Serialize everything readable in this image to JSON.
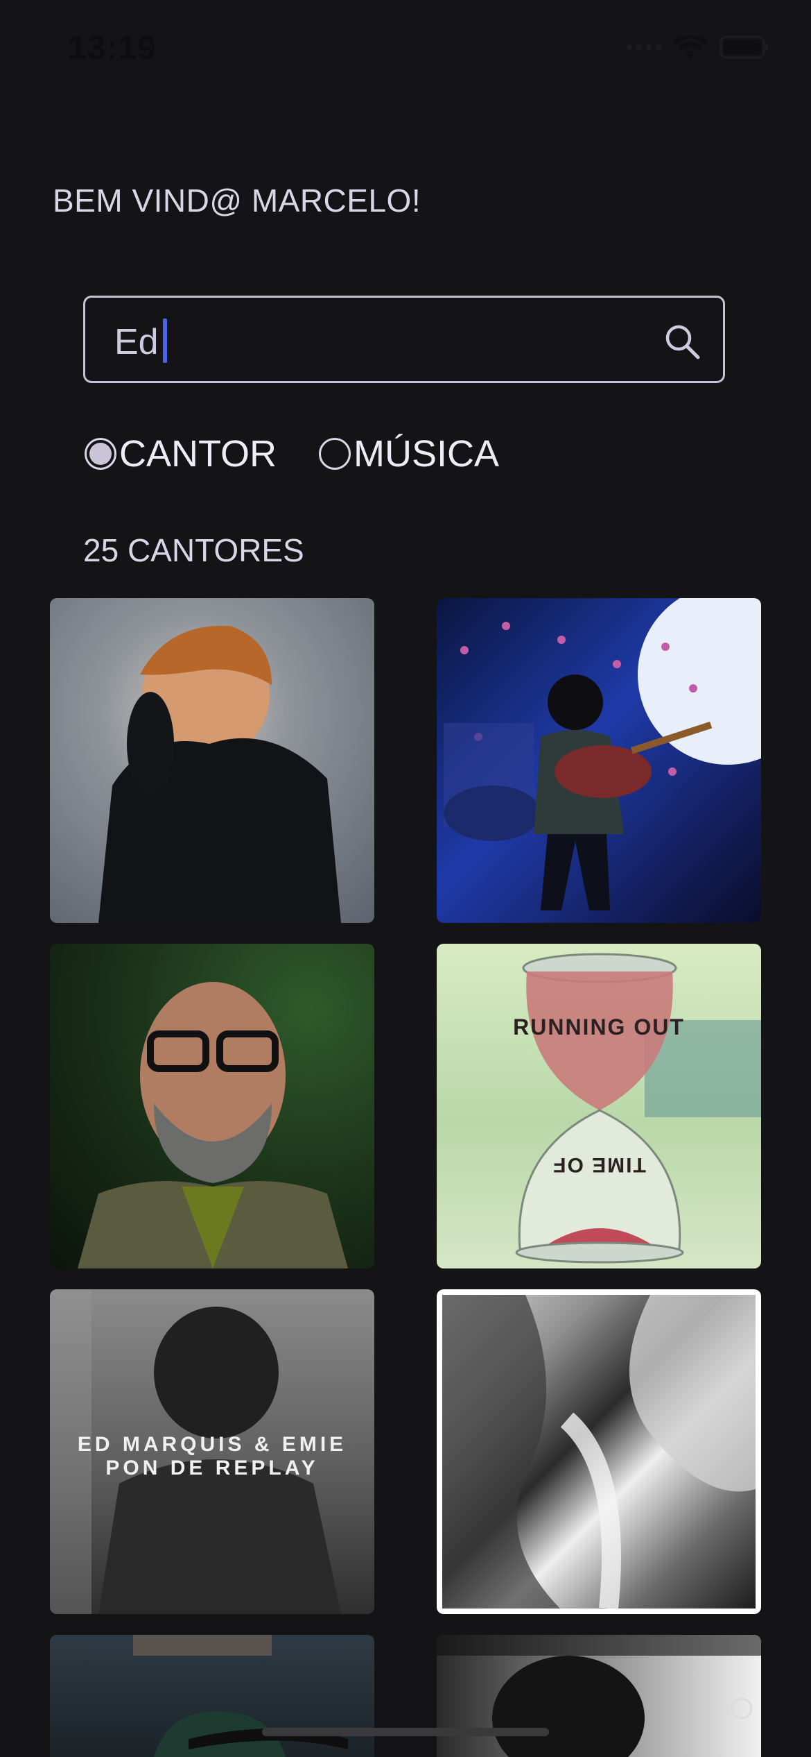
{
  "status_bar": {
    "time": "13:19"
  },
  "header": {
    "greeting": "BEM VIND@ MARCELO!"
  },
  "search": {
    "value": "Ed"
  },
  "filters": {
    "options": [
      {
        "label": "CANTOR",
        "selected": true
      },
      {
        "label": "MÚSICA",
        "selected": false
      }
    ]
  },
  "results": {
    "count_label": "25 CANTORES",
    "items": [
      {
        "image": "portrait-red-hair-singer"
      },
      {
        "image": "concert-guitarist-stage"
      },
      {
        "image": "bald-man-glasses-beard"
      },
      {
        "image": "hourglass-album-cover",
        "text_top": "RUNNING OUT",
        "text_bottom": "TIME OF"
      },
      {
        "image": "monochrome-album-cover",
        "text_line1": "ED MARQUIS & EMIE",
        "text_line2": "PON DE REPLAY"
      },
      {
        "image": "abstract-marble-art",
        "selected": true
      },
      {
        "image": "man-green-cap"
      },
      {
        "image": "monochrome-portrait"
      }
    ]
  },
  "colors": {
    "background": "#141416",
    "text": "#d9d6e8",
    "caret": "#4c63e6",
    "border": "#c6c2d6"
  }
}
